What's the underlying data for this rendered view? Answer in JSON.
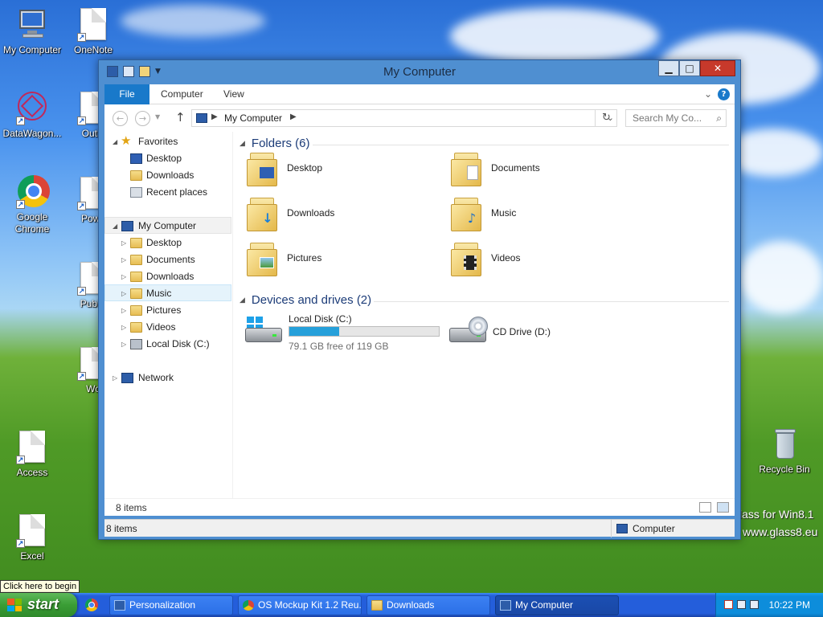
{
  "desktop": {
    "icons_left": [
      {
        "label": "My Computer"
      },
      {
        "label": "OneNote"
      },
      {
        "label": "DataWagon..."
      },
      {
        "label": "Outlo"
      },
      {
        "label": "Google Chrome"
      },
      {
        "label": "Powe"
      },
      {
        "label": "Publis"
      },
      {
        "label": "Wo"
      },
      {
        "label": "Access"
      },
      {
        "label": "Excel"
      }
    ],
    "recycle_bin_label": "Recycle Bin",
    "watermark_line1": "lass for Win8.1",
    "watermark_line2": "www.glass8.eu"
  },
  "window": {
    "title": "My Computer",
    "buttons": {
      "minimize": "▁",
      "maximize": "□",
      "close": "✕"
    },
    "ribbon_tabs": [
      "File",
      "Computer",
      "View"
    ],
    "help": "?",
    "address": {
      "location": "My Computer",
      "search_placeholder": "Search My Co..."
    },
    "nav": {
      "favorites_label": "Favorites",
      "favorites": [
        "Desktop",
        "Downloads",
        "Recent places"
      ],
      "computer_label": "My Computer",
      "computer_children": [
        "Desktop",
        "Documents",
        "Downloads",
        "Music",
        "Pictures",
        "Videos",
        "Local Disk (C:)"
      ],
      "network_label": "Network"
    },
    "folders_header": "Folders (6)",
    "folders": [
      {
        "name": "Desktop"
      },
      {
        "name": "Documents"
      },
      {
        "name": "Downloads"
      },
      {
        "name": "Music"
      },
      {
        "name": "Pictures"
      },
      {
        "name": "Videos"
      }
    ],
    "devices_header": "Devices and drives (2)",
    "drives": [
      {
        "name": "Local Disk (C:)",
        "free_text": "79.1 GB free of 119 GB",
        "used_fraction": 0.335
      },
      {
        "name": "CD Drive (D:)"
      }
    ],
    "status_items": "8 items",
    "statusbar_items": "8 items",
    "statusbar_zone": "Computer"
  },
  "tooltip": "Click here to begin",
  "taskbar": {
    "start_label": "start",
    "buttons": [
      {
        "label": "Personalization"
      },
      {
        "label": "OS Mockup Kit 1.2 Reu..."
      },
      {
        "label": "Downloads"
      },
      {
        "label": "My Computer"
      }
    ],
    "clock": "10:22 PM"
  },
  "colors": {
    "accent": "#1979ca",
    "taskbar": "#245edb",
    "start_green": "#3a9d35",
    "capacity_fill": "#26a0da"
  }
}
